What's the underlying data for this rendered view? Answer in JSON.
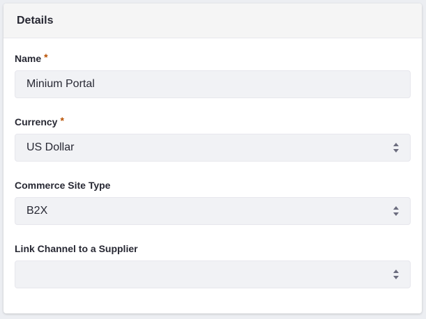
{
  "card": {
    "title": "Details"
  },
  "fields": {
    "name": {
      "label": "Name",
      "required_mark": "*",
      "value": "Minium Portal"
    },
    "currency": {
      "label": "Currency",
      "required_mark": "*",
      "selected": "US Dollar",
      "icon": "caret-double-icon"
    },
    "commerce_site_type": {
      "label": "Commerce Site Type",
      "selected": "B2X",
      "icon": "caret-double-icon"
    },
    "link_channel_supplier": {
      "label": "Link Channel to a Supplier",
      "selected": "",
      "icon": "caret-double-icon"
    }
  },
  "colors": {
    "required": "#b95000",
    "input_background": "#f1f2f5",
    "text": "#272833"
  }
}
